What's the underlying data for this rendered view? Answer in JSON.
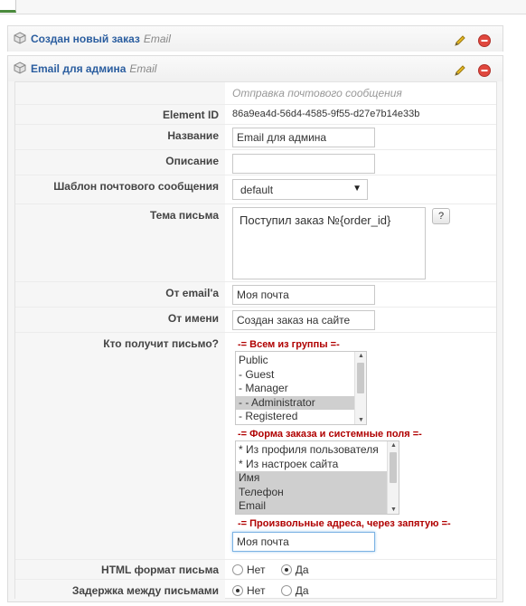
{
  "panels": [
    {
      "title": "Создан новый заказ",
      "type": "Email"
    },
    {
      "title": "Email для админа",
      "type": "Email"
    }
  ],
  "form": {
    "subtitle": "Отправка почтового сообщения",
    "element_id": {
      "label": "Element ID",
      "value": "86a9ea4d-56d4-4585-9f55-d27e7b14e33b"
    },
    "name": {
      "label": "Название",
      "value": "Email для админа"
    },
    "description": {
      "label": "Описание",
      "value": ""
    },
    "template": {
      "label": "Шаблон почтового сообщения",
      "value": "default"
    },
    "subject": {
      "label": "Тема письма",
      "value": "Поступил заказ №{order_id}",
      "help": "?"
    },
    "from_email": {
      "label": "От email'а",
      "value": "Моя почта"
    },
    "from_name": {
      "label": "От имени",
      "value": "Создан заказ на сайте"
    },
    "recipients": {
      "label": "Кто получит письмо?",
      "groups_heading": "-= Всем из группы =-",
      "groups": [
        {
          "text": "Public",
          "selected": false
        },
        {
          "text": "- Guest",
          "selected": false
        },
        {
          "text": "- Manager",
          "selected": false
        },
        {
          "text": "- - Administrator",
          "selected": true
        },
        {
          "text": "- Registered",
          "selected": false
        }
      ],
      "fields_heading": "-= Форма заказа и системные поля =-",
      "fields": [
        {
          "text": "* Из профиля пользователя",
          "selected": false
        },
        {
          "text": "* Из настроек сайта",
          "selected": false
        },
        {
          "text": "Имя",
          "selected": true
        },
        {
          "text": "Телефон",
          "selected": true
        },
        {
          "text": "Email",
          "selected": true
        }
      ],
      "custom_heading": "-= Произвольные адреса, через запятую =-",
      "custom_value": "Моя почта"
    },
    "html_format": {
      "label": "HTML формат письма",
      "options": [
        "Нет",
        "Да"
      ],
      "selected": "Да"
    },
    "delay": {
      "label": "Задержка между письмами",
      "options": [
        "Нет",
        "Да"
      ],
      "selected": "Нет"
    }
  },
  "colors": {
    "link": "#2a5d9f",
    "accent_red": "#b00000",
    "delete_icon": "#e0473d",
    "edit_icon": "#e8b923"
  }
}
